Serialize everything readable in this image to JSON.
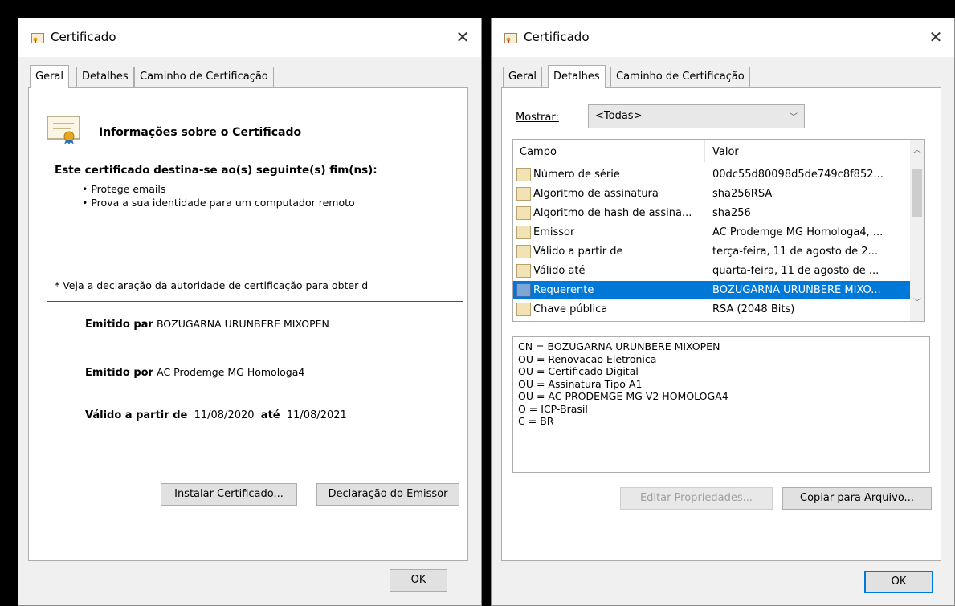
{
  "dialog1": {
    "title": "Certificado",
    "tabs": [
      "Geral",
      "Detalhes",
      "Caminho de Certificação"
    ],
    "info_title": "Informações sobre o Certificado",
    "purpose_heading": "Este certificado destina-se ao(s) seguinte(s) fim(ns):",
    "purposes": [
      "• Protege emails",
      "• Prova a sua identidade para um computador remoto"
    ],
    "note": "* Veja a declaração da autoridade de certificação para obter d",
    "issued_to_label": "Emitido par",
    "issued_to_value": "BOZUGARNA URUNBERE MIXOPEN",
    "issued_by_label": "Emitido por",
    "issued_by_value": "AC Prodemge MG Homologa4",
    "valid_from_label": "Válido a partir de",
    "valid_from_value": "11/08/2020",
    "valid_to_label": "até",
    "valid_to_value": "11/08/2021",
    "install_button": "Instalar Certificado...",
    "issuer_statement_button": "Declaração do Emissor",
    "ok_button": "OK"
  },
  "dialog2": {
    "title": "Certificado",
    "tabs": [
      "Geral",
      "Detalhes",
      "Caminho de Certificação"
    ],
    "show_label": "Mostrar:",
    "show_value": "<Todas>",
    "columns": [
      "Campo",
      "Valor"
    ],
    "rows": [
      {
        "field": "Número de série",
        "value": "00dc55d80098d5de749c8f852..."
      },
      {
        "field": "Algoritmo de assinatura",
        "value": "sha256RSA"
      },
      {
        "field": "Algoritmo de hash de assina...",
        "value": "sha256"
      },
      {
        "field": "Emissor",
        "value": "AC Prodemge MG Homologa4, ..."
      },
      {
        "field": "Válido a partir de",
        "value": "terça-feira, 11 de agosto de 2..."
      },
      {
        "field": "Válido até",
        "value": "quarta-feira, 11 de agosto de ..."
      },
      {
        "field": "Requerente",
        "value": "BOZUGARNA URUNBERE MIXO..."
      },
      {
        "field": "Chave pública",
        "value": "RSA (2048 Bits)"
      }
    ],
    "selected_row": 6,
    "detail_lines": [
      "CN = BOZUGARNA URUNBERE MIXOPEN",
      "OU = Renovacao Eletronica",
      "OU = Certificado Digital",
      "OU = Assinatura Tipo A1",
      "OU = AC PRODEMGE MG V2 HOMOLOGA4",
      "O = ICP-Brasil",
      "C = BR"
    ],
    "edit_button": "Editar Propriedades...",
    "copy_button": "Copiar para Arquivo...",
    "ok_button": "OK"
  },
  "icons": {
    "close": "close-icon",
    "certificate": "certificate-icon",
    "dropdown": "chevron-down-icon"
  }
}
